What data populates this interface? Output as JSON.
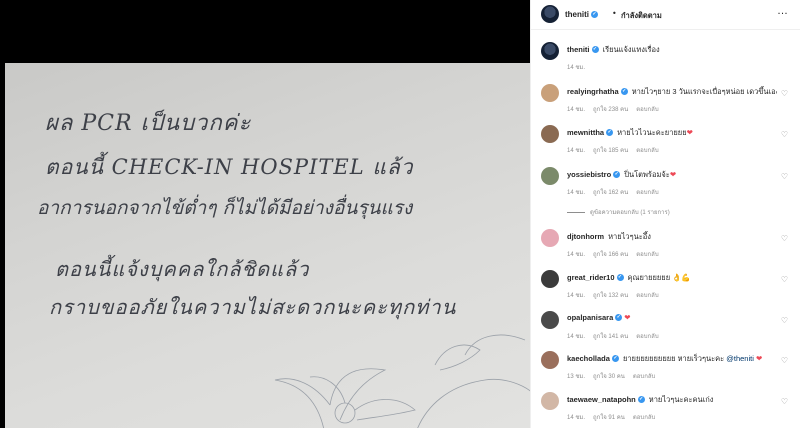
{
  "photo": {
    "lines": [
      "ผล PCR เป็นบวกค่ะ",
      "ตอนนี้ CHECK-IN HOSPITEL แล้ว",
      "อาการนอกจากไข้ต่ำๆ ก็ไม่ได้มีอย่างอื่นรุนแรง",
      "ตอนนี้แจ้งบุคคลใกล้ชิดแล้ว",
      "กราบขออภัยในความไม่สะดวกนะคะทุกท่าน"
    ]
  },
  "header": {
    "username": "theniti",
    "separator": "•",
    "follow_label": "กำลังติดตาม",
    "more_label": "…"
  },
  "caption": {
    "username": "theniti",
    "text": "เรียนแจ้งแทงเรื่อง",
    "time": "14 ชม."
  },
  "comments": [
    {
      "username": "realyingrhatha",
      "verified": true,
      "text": "หายไวๆยาย 3 วันแรกจะเบื่อๆหน่อย เดวขึ้นเองค่า",
      "time": "14 ชม.",
      "likes": "ถูกใจ 238 คน",
      "reply": "ตอบกลับ",
      "avatar_color": "#c9a07a"
    },
    {
      "username": "mewnittha",
      "verified": true,
      "text": "หายไวไวนะคะยายยย",
      "emoji": "❤",
      "time": "14 ชม.",
      "likes": "ถูกใจ 185 คน",
      "reply": "ตอบกลับ",
      "avatar_color": "#8a6a52"
    },
    {
      "username": "yossiebistro",
      "verified": true,
      "text": "ปิ่นโตพร้อมจ้ะ",
      "emoji": "❤",
      "time": "14 ชม.",
      "likes": "ถูกใจ 162 คน",
      "reply": "ตอบกลับ",
      "avatar_color": "#7b8a6a",
      "view_replies": "ดูข้อความตอบกลับ (1 รายการ)"
    },
    {
      "username": "djtonhorm",
      "verified": false,
      "text": "หายไวๆนะอึ้ง",
      "time": "14 ชม.",
      "likes": "ถูกใจ 166 คน",
      "reply": "ตอบกลับ",
      "avatar_color": "#e6a8b4"
    },
    {
      "username": "great_rider10",
      "verified": true,
      "text": "คุณยายยยยย",
      "emoji": "👌💪",
      "time": "14 ชม.",
      "likes": "ถูกใจ 132 คน",
      "reply": "ตอบกลับ",
      "avatar_color": "#3b3b3b"
    },
    {
      "username": "opalpanisara",
      "verified": true,
      "text": "",
      "emoji": "❤",
      "time": "14 ชม.",
      "likes": "ถูกใจ 141 คน",
      "reply": "ตอบกลับ",
      "avatar_color": "#4a4a4a"
    },
    {
      "username": "kaechollada",
      "verified": true,
      "text": "ยายยยยยยยยยย หายเร็วๆนะคะ",
      "mention": "@theniti",
      "emoji": "❤",
      "time": "13 ชม.",
      "likes": "ถูกใจ 30 คน",
      "reply": "ตอบกลับ",
      "avatar_color": "#9a6f5c"
    },
    {
      "username": "taewaew_natapohn",
      "verified": true,
      "text": "หายไวๆนะคะคนเก่ง",
      "time": "14 ชม.",
      "likes": "ถูกใจ 91 คน",
      "reply": "ตอบกลับ",
      "avatar_color": "#d2b7a6"
    }
  ],
  "colors": {
    "verified": "#3897f0",
    "heart": "#ed4956",
    "meta_text": "#8e8e8e"
  }
}
